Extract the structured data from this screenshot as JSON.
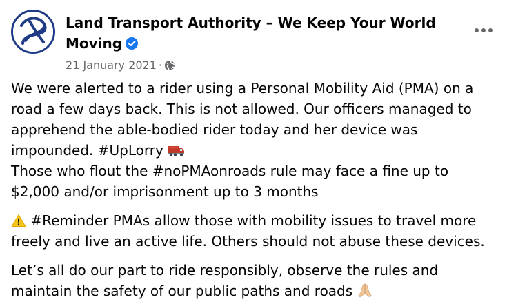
{
  "post": {
    "page_name": "Land Transport Authority – We Keep Your World Moving",
    "date": "21 January 2021",
    "separator": "·",
    "audience_icon": "globe-icon",
    "verified_icon": "verified-badge-icon",
    "menu_icon": "more-options-icon",
    "colors": {
      "text": "#050505",
      "meta": "#65676b",
      "verified": "#1877f2",
      "avatar_ring": "#1f3b85"
    },
    "paragraphs": [
      {
        "lines": [
          "We were alerted to a rider using a Personal Mobility Aid (PMA) on a road a few days back. This is not allowed. Our officers managed to apprehend the able-bodied rider today and her device was impounded. #UpLorry"
        ],
        "emoji_after_first": "truck-emoji",
        "second_line": "Those who flout the #noPMAonroads rule may face a fine up to $2,000 and/or imprisonment up to 3 months"
      },
      {
        "emoji_before": "warning-emoji",
        "text": "#Reminder PMAs allow those with mobility issues to travel more freely and live an active life. Others should not abuse these devices."
      },
      {
        "text": "Let’s all do our part to ride responsibly, observe the rules and maintain the safety of our public paths and roads",
        "emoji_after": "folded-hands-emoji"
      }
    ]
  }
}
